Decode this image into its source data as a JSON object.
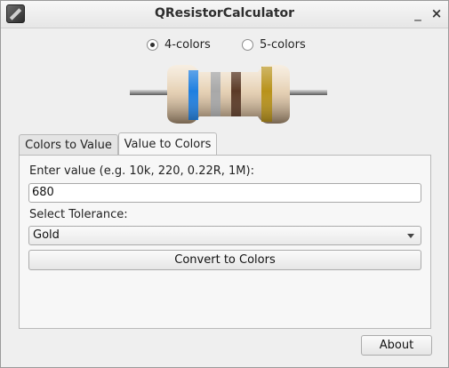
{
  "window": {
    "title": "QResistorCalculator",
    "minimize_glyph": "_",
    "close_glyph": "×"
  },
  "mode": {
    "options": [
      {
        "label": "4-colors",
        "selected": true
      },
      {
        "label": "5-colors",
        "selected": false
      }
    ]
  },
  "resistor_preview": {
    "bands": [
      "#1f7fe0",
      "#a8a8a8",
      "#5b3a26",
      "#b8921a"
    ],
    "body_color": "#e6d1b5"
  },
  "tabs": [
    {
      "label": "Colors to Value",
      "active": false
    },
    {
      "label": "Value to Colors",
      "active": true
    }
  ],
  "value_to_colors": {
    "value_label": "Enter value (e.g. 10k, 220, 0.22R, 1M):",
    "value": "680",
    "tolerance_label": "Select Tolerance:",
    "tolerance": "Gold",
    "convert_label": "Convert to Colors"
  },
  "about_label": "About"
}
